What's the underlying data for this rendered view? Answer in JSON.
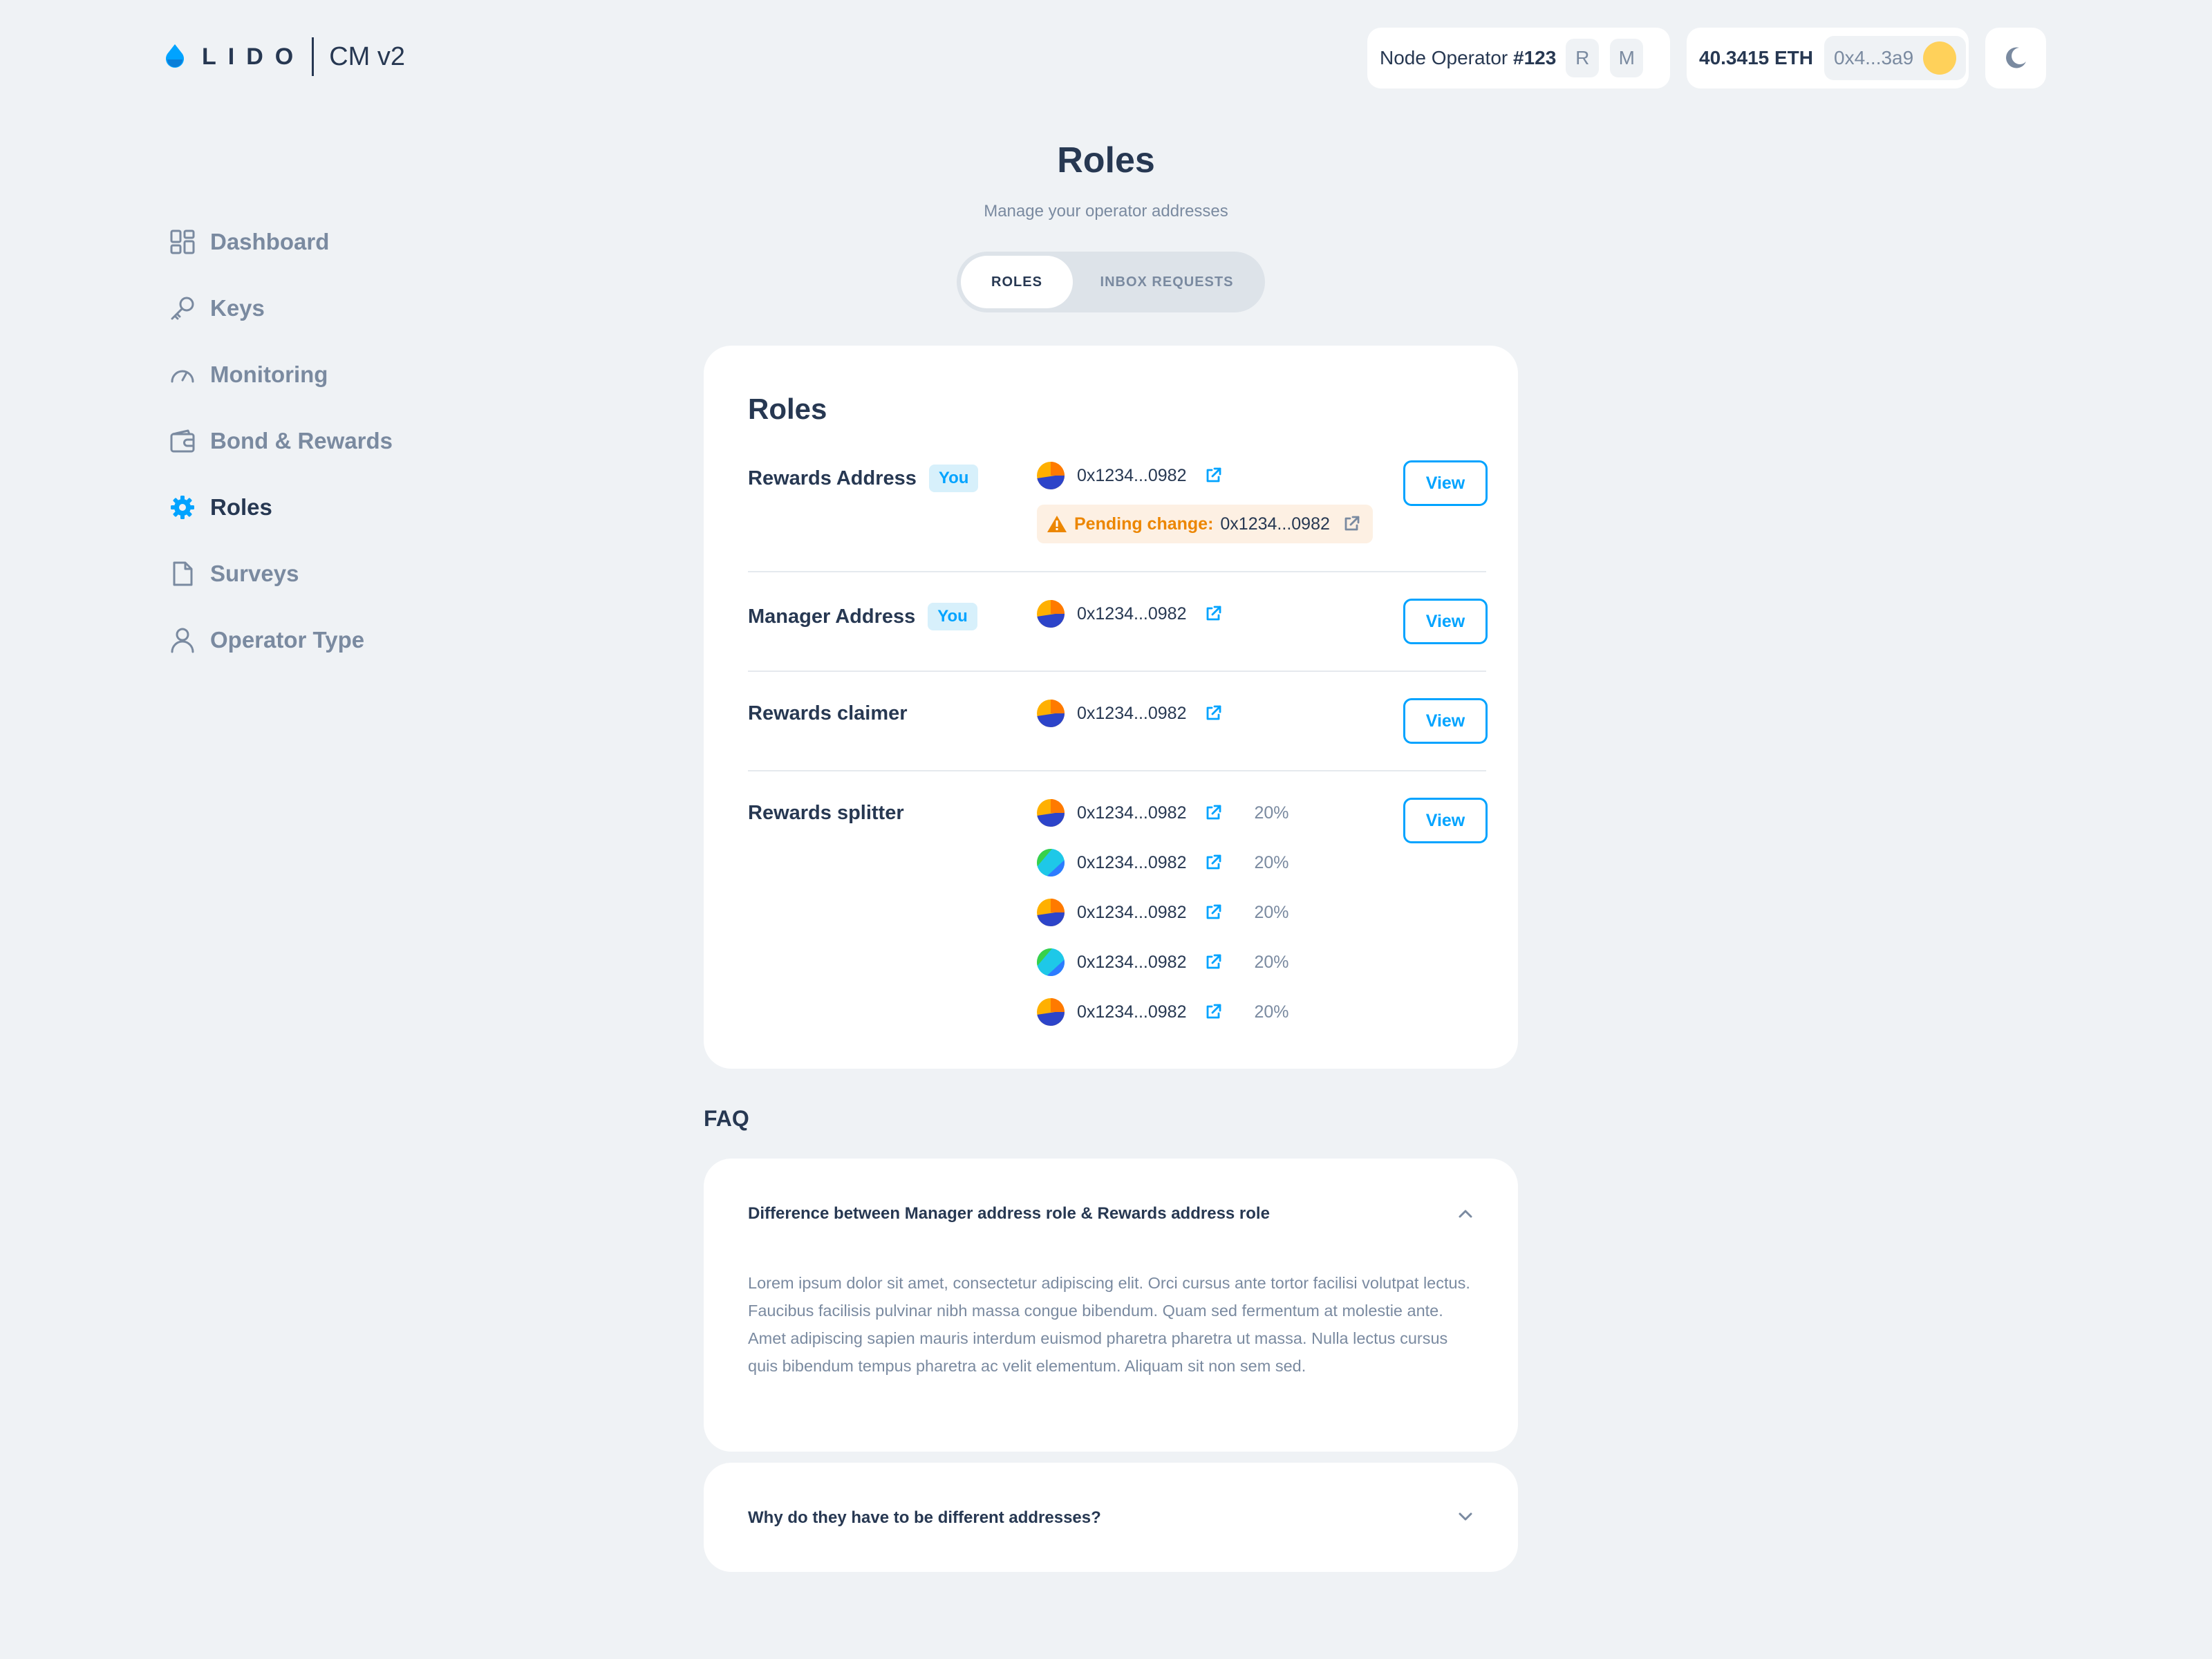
{
  "header": {
    "logo_word": "LIDO",
    "product": "CM v2",
    "operator": {
      "prefix": "Node Operator ",
      "number": "#123",
      "tag_r": "R",
      "tag_m": "M"
    },
    "wallet": {
      "balance": "40.3415 ETH",
      "address": "0x4...3a9",
      "avatar_color": "#ffd15a"
    }
  },
  "sidebar": {
    "items": [
      {
        "label": "Dashboard",
        "icon": "dashboard-icon"
      },
      {
        "label": "Keys",
        "icon": "key-icon"
      },
      {
        "label": "Monitoring",
        "icon": "gauge-icon"
      },
      {
        "label": "Bond & Rewards",
        "icon": "wallet-icon"
      },
      {
        "label": "Roles",
        "icon": "gear-icon",
        "active": true
      },
      {
        "label": "Surveys",
        "icon": "document-icon"
      },
      {
        "label": "Operator Type",
        "icon": "user-icon"
      }
    ]
  },
  "page": {
    "title": "Roles",
    "subtitle": "Manage your operator addresses",
    "tabs": [
      "ROLES",
      "INBOX REQUESTS"
    ]
  },
  "roles": {
    "title": "Roles",
    "view_label": "View",
    "you_label": "You",
    "pending_label": "Pending change:",
    "rows": [
      {
        "name": "Rewards Address",
        "you": true,
        "addresses": [
          "0x1234...0982"
        ],
        "pending_address": "0x1234...0982"
      },
      {
        "name": "Manager Address",
        "you": true,
        "addresses": [
          "0x1234...0982"
        ]
      },
      {
        "name": "Rewards claimer",
        "addresses": [
          "0x1234...0982"
        ]
      },
      {
        "name": "Rewards splitter",
        "addresses": [
          "0x1234...0982",
          "0x1234...0982",
          "0x1234...0982",
          "0x1234...0982",
          "0x1234...0982"
        ],
        "shares": [
          "20%",
          "20%",
          "20%",
          "20%",
          "20%"
        ]
      }
    ]
  },
  "faq": {
    "heading": "FAQ",
    "items": [
      {
        "question": "Difference between Manager address role & Rewards address role",
        "answer": "Lorem ipsum dolor sit amet, consectetur adipiscing elit. Orci cursus ante tortor facilisi volutpat lectus. Faucibus facilisis pulvinar nibh massa congue bibendum. Quam sed fermentum at molestie ante. Amet adipiscing sapien mauris interdum euismod pharetra pharetra ut massa. Nulla lectus cursus quis bibendum tempus pharetra ac velit elementum. Aliquam sit non sem sed.",
        "expanded": true
      },
      {
        "question": "Why do they have to be different addresses?",
        "expanded": false
      }
    ]
  },
  "colors": {
    "accent": "#00a3ff",
    "warning": "#ec8600",
    "text": "#273852",
    "muted": "#7a8aa0",
    "background": "#eff2f5"
  }
}
